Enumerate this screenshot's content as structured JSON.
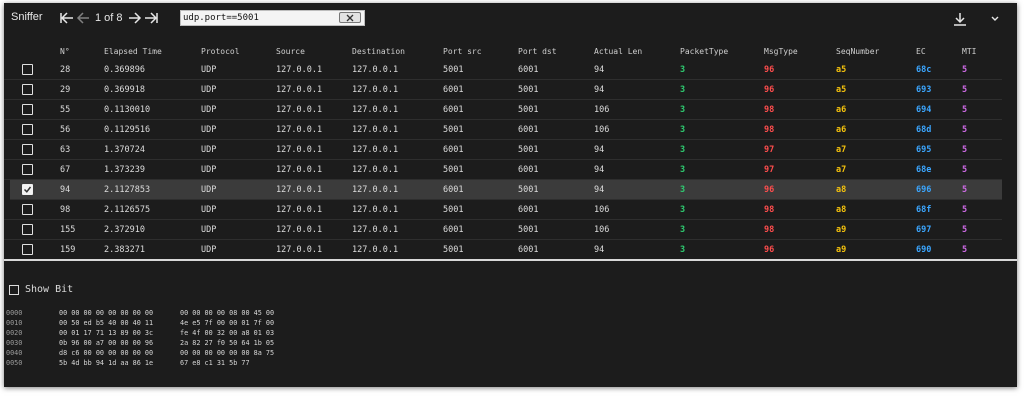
{
  "app": {
    "title": "Sniffer"
  },
  "pager": {
    "text": "1 of 8"
  },
  "search": {
    "value": "udp.port==5001"
  },
  "colors": {
    "packet_type": "#2ecc71",
    "msg_type": "#ff4d4d",
    "seq": "#f4c20d",
    "ec": "#3ba6ff",
    "mti": "#d06ce8"
  },
  "table": {
    "columns": [
      "N°",
      "Elapsed Time",
      "Protocol",
      "Source",
      "Destination",
      "Port src",
      "Port dst",
      "Actual Len",
      "PacketType",
      "MsgType",
      "SeqNumber",
      "EC",
      "MTI"
    ],
    "rows": [
      {
        "n": "28",
        "time": "0.369896",
        "proto": "UDP",
        "src": "127.0.0.1",
        "dst": "127.0.0.1",
        "psrc": "5001",
        "pdst": "6001",
        "len": "94",
        "ptype": "3",
        "msg": "96",
        "seq": "a5",
        "ec": "68c",
        "mti": "5",
        "checked": false
      },
      {
        "n": "29",
        "time": "0.369918",
        "proto": "UDP",
        "src": "127.0.0.1",
        "dst": "127.0.0.1",
        "psrc": "6001",
        "pdst": "5001",
        "len": "94",
        "ptype": "3",
        "msg": "96",
        "seq": "a5",
        "ec": "693",
        "mti": "5",
        "checked": false
      },
      {
        "n": "55",
        "time": "0.1130010",
        "proto": "UDP",
        "src": "127.0.0.1",
        "dst": "127.0.0.1",
        "psrc": "6001",
        "pdst": "5001",
        "len": "106",
        "ptype": "3",
        "msg": "98",
        "seq": "a6",
        "ec": "694",
        "mti": "5",
        "checked": false
      },
      {
        "n": "56",
        "time": "0.1129516",
        "proto": "UDP",
        "src": "127.0.0.1",
        "dst": "127.0.0.1",
        "psrc": "5001",
        "pdst": "6001",
        "len": "106",
        "ptype": "3",
        "msg": "98",
        "seq": "a6",
        "ec": "68d",
        "mti": "5",
        "checked": false
      },
      {
        "n": "63",
        "time": "1.370724",
        "proto": "UDP",
        "src": "127.0.0.1",
        "dst": "127.0.0.1",
        "psrc": "6001",
        "pdst": "5001",
        "len": "94",
        "ptype": "3",
        "msg": "97",
        "seq": "a7",
        "ec": "695",
        "mti": "5",
        "checked": false
      },
      {
        "n": "67",
        "time": "1.373239",
        "proto": "UDP",
        "src": "127.0.0.1",
        "dst": "127.0.0.1",
        "psrc": "5001",
        "pdst": "6001",
        "len": "94",
        "ptype": "3",
        "msg": "97",
        "seq": "a7",
        "ec": "68e",
        "mti": "5",
        "checked": false
      },
      {
        "n": "94",
        "time": "2.1127853",
        "proto": "UDP",
        "src": "127.0.0.1",
        "dst": "127.0.0.1",
        "psrc": "6001",
        "pdst": "5001",
        "len": "94",
        "ptype": "3",
        "msg": "96",
        "seq": "a8",
        "ec": "696",
        "mti": "5",
        "checked": true
      },
      {
        "n": "98",
        "time": "2.1126575",
        "proto": "UDP",
        "src": "127.0.0.1",
        "dst": "127.0.0.1",
        "psrc": "5001",
        "pdst": "6001",
        "len": "106",
        "ptype": "3",
        "msg": "98",
        "seq": "a8",
        "ec": "68f",
        "mti": "5",
        "checked": false
      },
      {
        "n": "155",
        "time": "2.372910",
        "proto": "UDP",
        "src": "127.0.0.1",
        "dst": "127.0.0.1",
        "psrc": "6001",
        "pdst": "5001",
        "len": "106",
        "ptype": "3",
        "msg": "98",
        "seq": "a9",
        "ec": "697",
        "mti": "5",
        "checked": false
      },
      {
        "n": "159",
        "time": "2.383271",
        "proto": "UDP",
        "src": "127.0.0.1",
        "dst": "127.0.0.1",
        "psrc": "5001",
        "pdst": "6001",
        "len": "94",
        "ptype": "3",
        "msg": "96",
        "seq": "a9",
        "ec": "690",
        "mti": "5",
        "checked": false
      }
    ]
  },
  "detail": {
    "show_bit_label": "Show Bit",
    "hex": [
      {
        "off": "0000",
        "g1": "00 00 00 00 00 00 00 00",
        "g2": "00 00 00 00 08 00 45 00"
      },
      {
        "off": "0010",
        "g1": "00 50 ed b5 40 00 40 11",
        "g2": "4e e5 7f 00 00 01 7f 00"
      },
      {
        "off": "0020",
        "g1": "00 01 17 71 13 89 00 3c",
        "g2": "fe 4f 00 32 00 a8 01 03"
      },
      {
        "off": "0030",
        "g1": "0b 96 00 a7 00 00 00 96",
        "g2": "2a 82 27 f0 50 64 1b 05"
      },
      {
        "off": "0040",
        "g1": "d8 c6 00 00 00 00 00 00",
        "g2": "00 00 00 00 00 00 8a 75"
      },
      {
        "off": "0050",
        "g1": "5b 4d bb 94 1d aa 86 1e",
        "g2": "67 e8 c1 31 5b 77"
      }
    ]
  }
}
